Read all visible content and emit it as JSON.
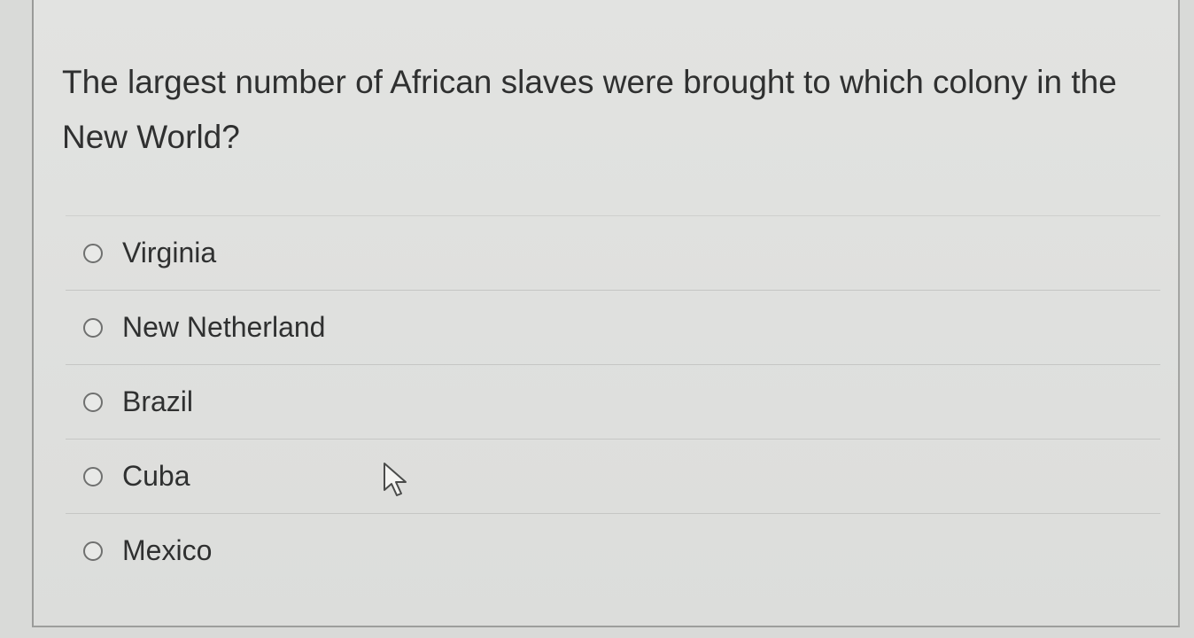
{
  "question": {
    "text": "The largest number of African slaves were brought to which colony in the New World?"
  },
  "answers": [
    {
      "label": "Virginia",
      "selected": false
    },
    {
      "label": "New Netherland",
      "selected": false
    },
    {
      "label": "Brazil",
      "selected": false
    },
    {
      "label": "Cuba",
      "selected": false
    },
    {
      "label": "Mexico",
      "selected": false
    }
  ],
  "icons": {
    "radio": "radio-unchecked-icon",
    "cursor": "mouse-pointer-icon"
  },
  "colors": {
    "background": "#dfe0de",
    "text": "#2f3030",
    "radio_border": "#6f706f"
  }
}
